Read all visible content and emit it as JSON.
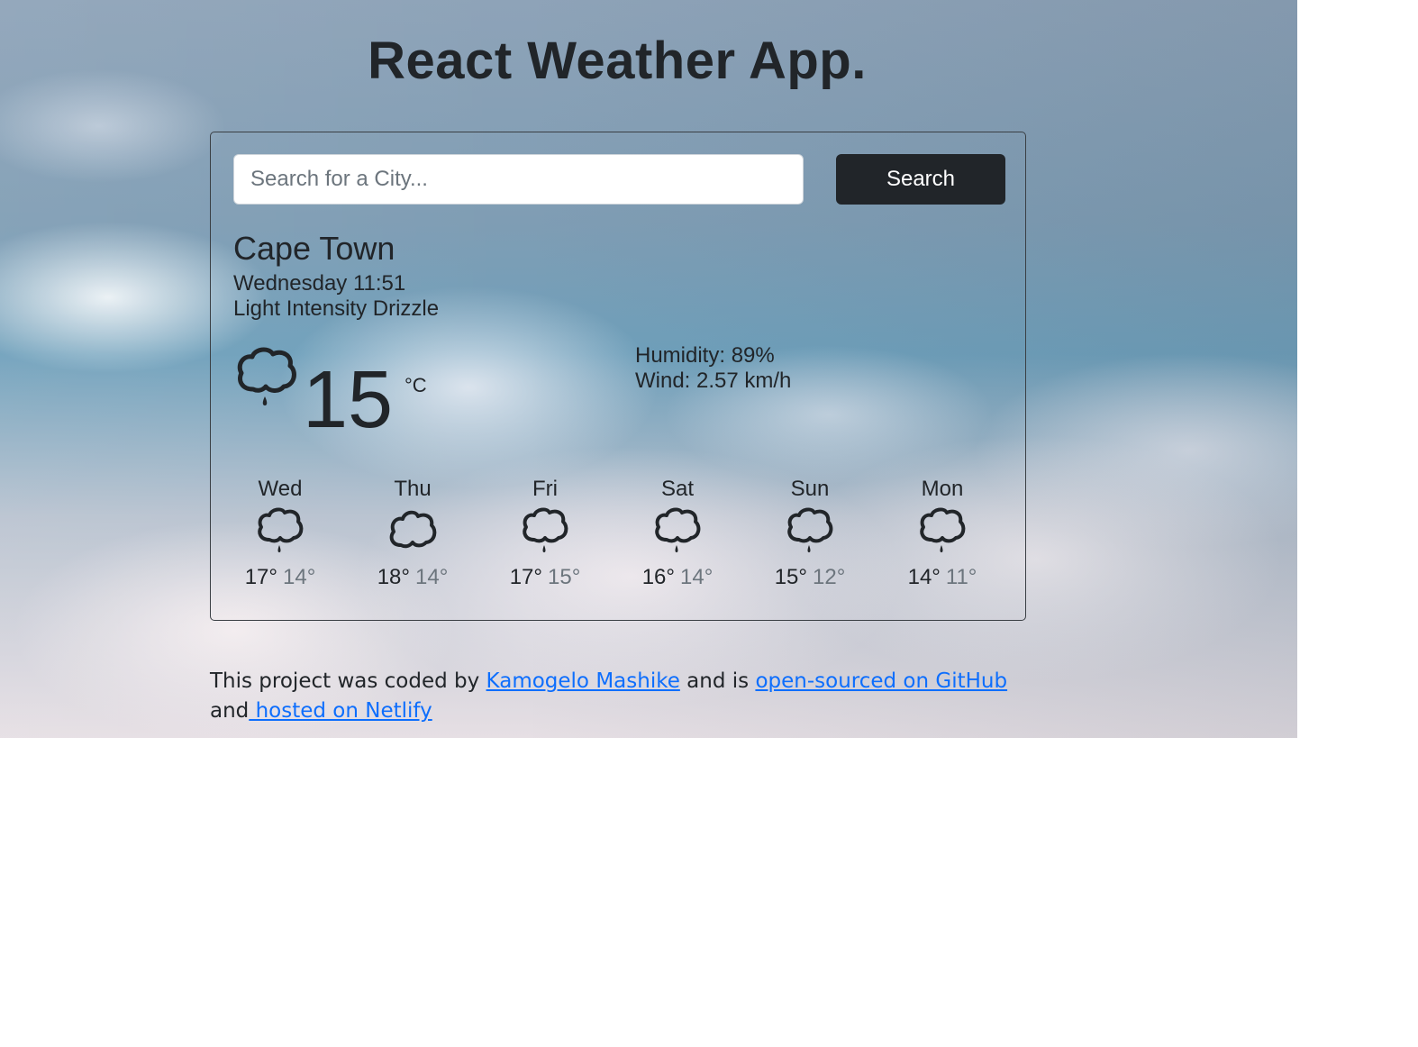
{
  "app": {
    "title": "React Weather App."
  },
  "search": {
    "placeholder": "Search for a City...",
    "value": "",
    "button_label": "Search"
  },
  "current": {
    "city": "Cape Town",
    "datetime": "Wednesday 11:51",
    "description": "Light Intensity Drizzle",
    "icon": "drizzle-cloud-icon",
    "temperature": "15",
    "unit": "°C",
    "humidity": "Humidity: 89%",
    "wind": "Wind: 2.57 km/h"
  },
  "forecast": [
    {
      "day": "Wed",
      "icon": "drizzle-cloud-icon",
      "max": "17°",
      "min": "14°"
    },
    {
      "day": "Thu",
      "icon": "cloud-icon",
      "max": "18°",
      "min": "14°"
    },
    {
      "day": "Fri",
      "icon": "drizzle-cloud-icon",
      "max": "17°",
      "min": "15°"
    },
    {
      "day": "Sat",
      "icon": "drizzle-cloud-icon",
      "max": "16°",
      "min": "14°"
    },
    {
      "day": "Sun",
      "icon": "drizzle-cloud-icon",
      "max": "15°",
      "min": "12°"
    },
    {
      "day": "Mon",
      "icon": "drizzle-cloud-icon",
      "max": "14°",
      "min": "11°"
    }
  ],
  "footer": {
    "text_1": "This project was coded by ",
    "link_author": "Kamogelo Mashike",
    "text_2": " and is ",
    "link_github": "open-sourced on GitHub",
    "text_3": " and",
    "link_netlify": " hosted on Netlify"
  },
  "colors": {
    "text": "#212529",
    "button_bg": "#212529",
    "link": "#0d6efd",
    "muted": "#6c757d"
  }
}
